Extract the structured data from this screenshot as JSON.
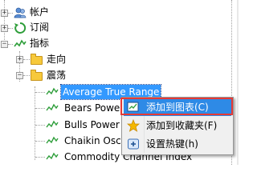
{
  "tree": {
    "root_items": [
      {
        "label": "帐户",
        "icon": "accounts-icon"
      },
      {
        "label": "订阅",
        "icon": "subscription-icon"
      },
      {
        "label": "指标",
        "icon": "indicators-icon"
      }
    ],
    "folders": [
      {
        "label": "走向",
        "expander": "+"
      },
      {
        "label": "震荡",
        "expander": "−"
      }
    ],
    "indicators": [
      "Average True Range",
      "Bears Power",
      "Bulls Power",
      "Chaikin Oscillator",
      "Commodity Channel Index"
    ]
  },
  "context_menu": {
    "items": [
      {
        "label": "添加到图表(C)",
        "icon": "add-chart-icon"
      },
      {
        "label": "添加到收藏夹(F)",
        "icon": "favorite-star-icon"
      },
      {
        "label": "设置热键(h)",
        "icon": "hotkey-icon"
      }
    ]
  },
  "colors": {
    "selection": "#3399ff",
    "menu_highlight": "#2e8ae6",
    "focus_outline": "#e53935"
  }
}
